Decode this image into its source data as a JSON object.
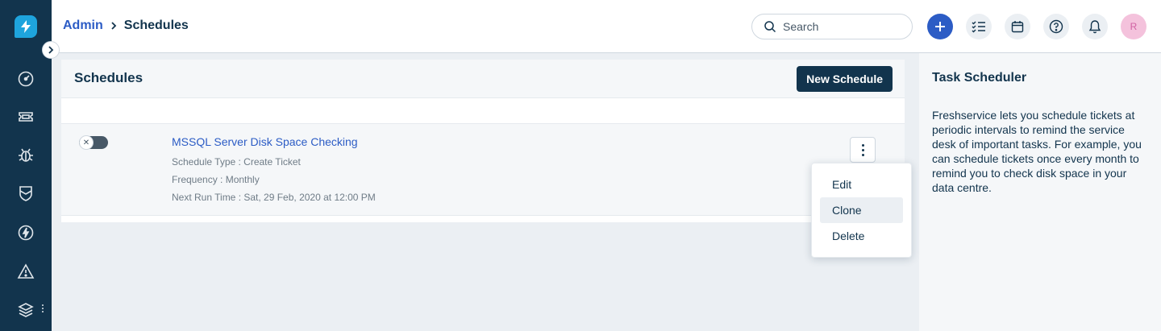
{
  "header": {
    "breadcrumb_parent": "Admin",
    "breadcrumb_current": "Schedules",
    "search_placeholder": "Search",
    "avatar_initial": "R"
  },
  "main": {
    "title": "Schedules",
    "new_schedule_label": "New Schedule",
    "schedule": {
      "name": "MSSQL Server Disk Space Checking",
      "type": "Schedule Type : Create Ticket",
      "frequency": "Frequency : Monthly",
      "next_run": "Next Run Time : Sat, 29 Feb, 2020 at 12:00 PM",
      "enabled": false
    }
  },
  "dropdown": {
    "items": [
      {
        "label": "Edit"
      },
      {
        "label": "Clone"
      },
      {
        "label": "Delete"
      }
    ]
  },
  "side": {
    "title": "Task Scheduler",
    "description": "Freshservice lets you schedule tickets at periodic intervals to remind the service desk of important tasks. For example, you can schedule tickets once every month to remind you to check disk space in your data centre."
  },
  "nav": {
    "icons": [
      "dashboard-icon",
      "tickets-icon",
      "problems-icon",
      "changes-icon",
      "releases-icon",
      "alerts-icon",
      "assets-icon"
    ]
  },
  "colors": {
    "nav_bg": "#12344d",
    "link": "#2c5cc5",
    "primary_button": "#12344d",
    "logo": "#1ea4dd"
  }
}
